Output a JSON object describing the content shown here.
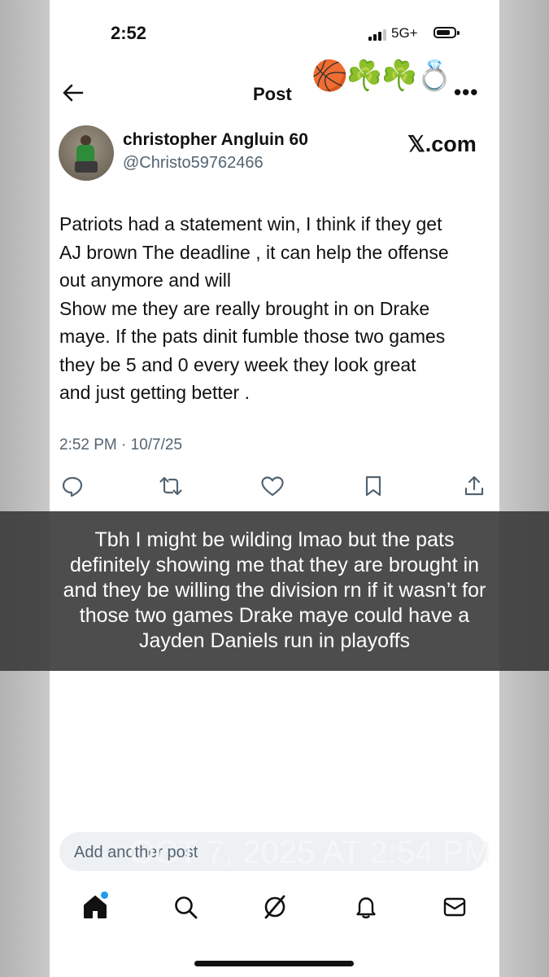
{
  "status_bar": {
    "time": "2:52",
    "network": "5G+"
  },
  "header": {
    "title": "Post",
    "emojis": "🏀☘️☘️💍"
  },
  "author": {
    "display_name": "christopher Angluin 60",
    "handle": "@Christo59762466",
    "source_label": "𝕏.com"
  },
  "tweet": {
    "lines": [
      "Patriots had a statement win, I think if they get",
      "AJ brown The deadline , it can help the offense",
      "out anymore and will",
      "Show me they are really brought in on Drake",
      "maye. If the pats dinit fumble those two games",
      "they be 5 and 0 every week they look great",
      "and just getting better ."
    ],
    "timestamp": "2:52 PM · 10/7/25"
  },
  "actions": [
    "reply-icon",
    "repost-icon",
    "like-icon",
    "bookmark-icon",
    "share-icon"
  ],
  "overlay": {
    "lines": [
      "Tbh I might be wilding lmao but the pats",
      "definitely showing me that they are brought in",
      "and they be willing the division rn if it wasn’t for",
      "those two games Drake maye could have a",
      "Jayden Daniels run in playoffs"
    ]
  },
  "composer": {
    "placeholder": "Add another post",
    "watermark": "OCT 7, 2025 AT 2:54 PM"
  },
  "bottom_nav": [
    "home-icon",
    "search-icon",
    "grok-icon",
    "notifications-icon",
    "messages-icon"
  ],
  "colors": {
    "accent": "#1d9bf0",
    "secondary_text": "#536471",
    "overlay_bg": "#3a3a3a"
  }
}
